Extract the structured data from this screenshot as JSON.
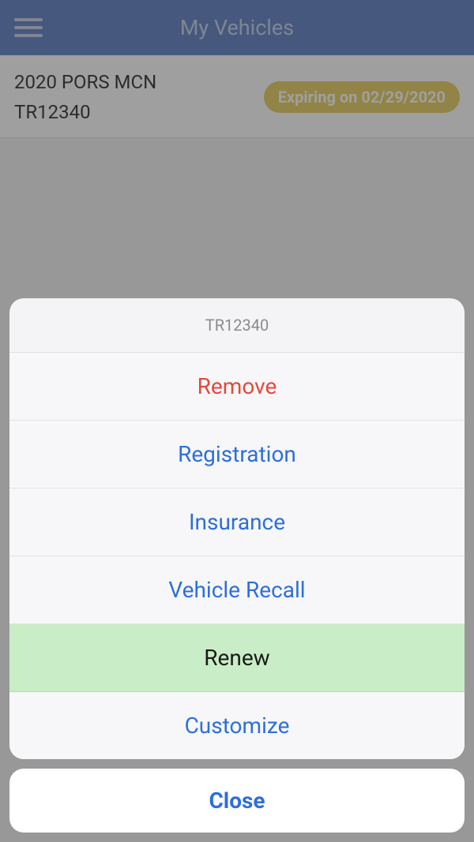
{
  "header": {
    "title": "My Vehicles"
  },
  "vehicle": {
    "name": "2020 PORS MCN",
    "plate": "TR12340",
    "expiry_label": "Expiring on 02/29/2020"
  },
  "sheet": {
    "title": "TR12340",
    "remove": "Remove",
    "registration": "Registration",
    "insurance": "Insurance",
    "recall": "Vehicle Recall",
    "renew": "Renew",
    "customize": "Customize",
    "close": "Close"
  }
}
